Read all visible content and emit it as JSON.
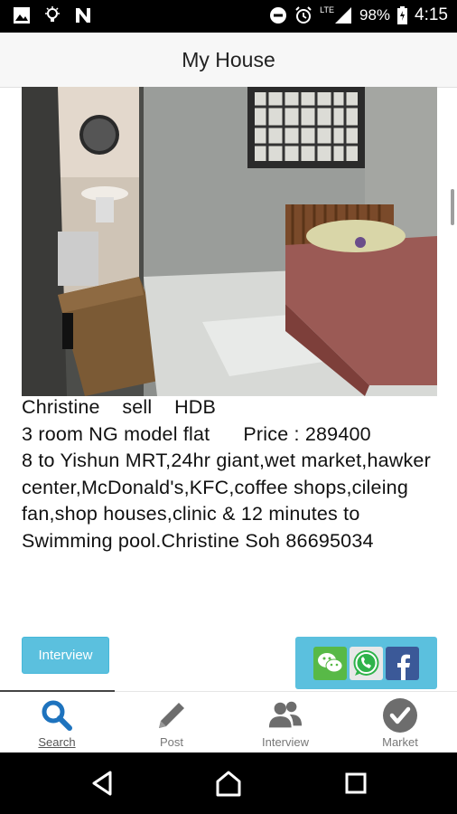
{
  "status_bar": {
    "battery": "98%",
    "time": "4:15",
    "network": "LTE",
    "left_icons": [
      "image-icon",
      "lightbulb-icon",
      "n-icon"
    ],
    "right_icons": [
      "do-not-disturb-icon",
      "alarm-icon",
      "signal-icon",
      "battery-icon"
    ]
  },
  "header": {
    "title": "My House"
  },
  "listing": {
    "photo_icon": "room-photo",
    "line1": "Christine    sell    HDB",
    "line2": "3 room NG model flat      Price : 289400",
    "details": "8 to Yishun MRT,24hr giant,wet market,hawker center,McDonald's,KFC,coffee shops,cileing fan,shop houses,clinic & 12 minutes to Swimming pool.Christine Soh 86695034",
    "interview_label": "Interview",
    "share_icons": [
      "wechat-icon",
      "whatsapp-icon",
      "facebook-icon"
    ]
  },
  "tabs": [
    {
      "label": "Search",
      "icon": "search-icon",
      "active": true
    },
    {
      "label": "Post",
      "icon": "pencil-icon",
      "active": false
    },
    {
      "label": "Interview",
      "icon": "people-icon",
      "active": false
    },
    {
      "label": "Market",
      "icon": "check-circle-icon",
      "active": false
    }
  ],
  "colors": {
    "accent": "#5bc0de",
    "active_tab": "#1e73be",
    "inactive_tab": "#6d6d6d"
  }
}
